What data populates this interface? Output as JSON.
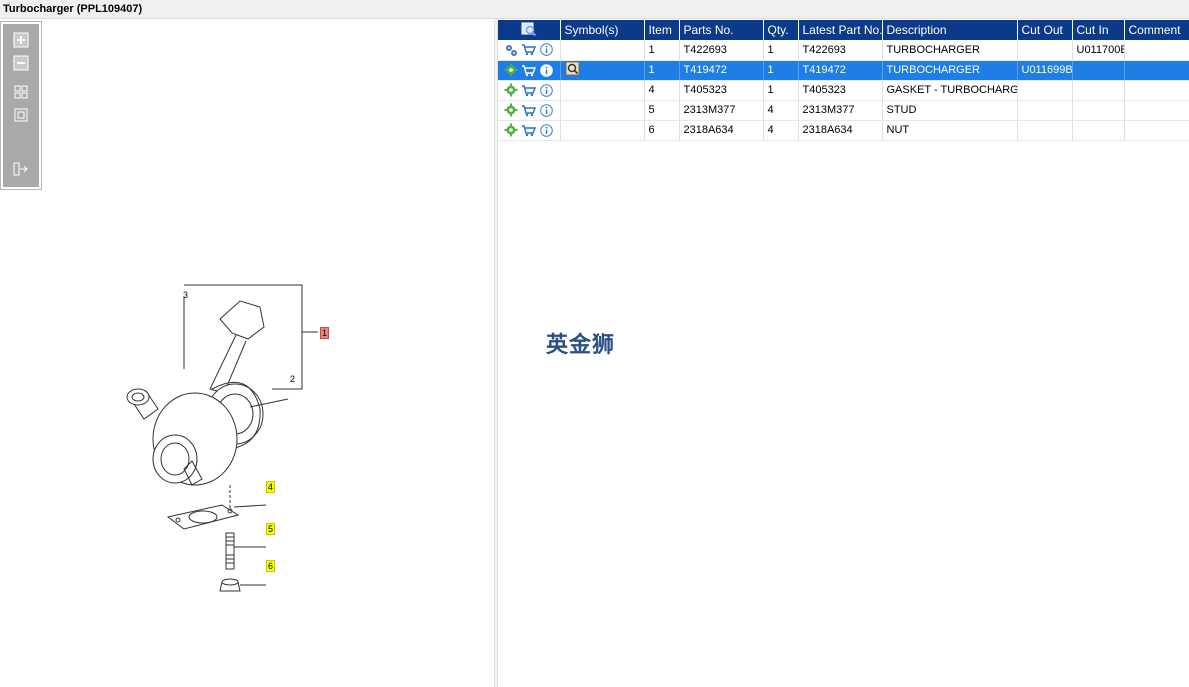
{
  "window": {
    "title": "Turbocharger (PPL109407)"
  },
  "toolbox": {
    "icons": [
      "zoom-in-icon",
      "zoom-out-icon",
      "fit-all-icon",
      "fit-window-icon",
      "split-view-icon"
    ]
  },
  "drawing": {
    "callouts": [
      {
        "label": "1",
        "style": "red"
      },
      {
        "label": "2",
        "style": "plain"
      },
      {
        "label": "3",
        "style": "plain"
      },
      {
        "label": "4",
        "style": "yellow"
      },
      {
        "label": "5",
        "style": "yellow"
      },
      {
        "label": "6",
        "style": "yellow"
      }
    ]
  },
  "table": {
    "columns": {
      "view": "",
      "symbols": "Symbol(s)",
      "item": "Item",
      "parts_no": "Parts No.",
      "qty": "Qty.",
      "latest": "Latest Part No.",
      "description": "Description",
      "cut_out": "Cut Out",
      "cut_in": "Cut In",
      "comment": "Comment"
    },
    "rows": [
      {
        "item": "1",
        "parts_no": "T422693",
        "qty": "1",
        "latest": "T422693",
        "description": "TURBOCHARGER",
        "cut_out": "",
        "cut_in": "U011700E",
        "comment": ""
      },
      {
        "item": "1",
        "parts_no": "T419472",
        "qty": "1",
        "latest": "T419472",
        "description": "TURBOCHARGER",
        "cut_out": "U011699B",
        "cut_in": "",
        "comment": ""
      },
      {
        "item": "4",
        "parts_no": "T405323",
        "qty": "1",
        "latest": "T405323",
        "description": "GASKET - TURBOCHARGER",
        "cut_out": "",
        "cut_in": "",
        "comment": ""
      },
      {
        "item": "5",
        "parts_no": "2313M377",
        "qty": "4",
        "latest": "2313M377",
        "description": "STUD",
        "cut_out": "",
        "cut_in": "",
        "comment": ""
      },
      {
        "item": "6",
        "parts_no": "2318A634",
        "qty": "4",
        "latest": "2318A634",
        "description": "NUT",
        "cut_out": "",
        "cut_in": "",
        "comment": ""
      }
    ],
    "selected_row": 1
  },
  "watermark": {
    "text": "英金狮"
  },
  "colors": {
    "header_bg": "#0b3a8a",
    "selected_row": "#1e7ee6",
    "callout_yellow": "#ffff00",
    "callout_red": "#f08080"
  }
}
